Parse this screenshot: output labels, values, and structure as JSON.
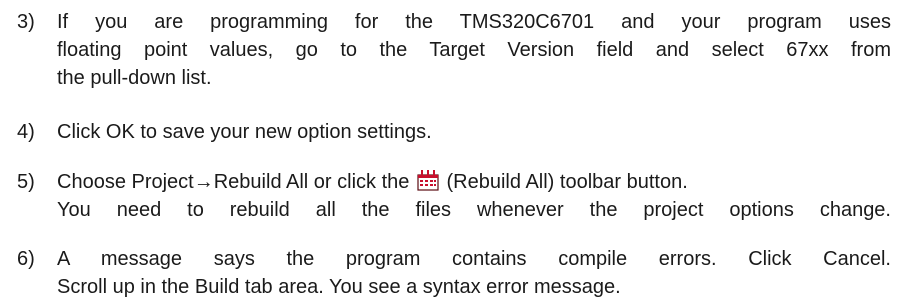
{
  "steps": [
    {
      "number": "3)",
      "lines": [
        "If you are programming for the TMS320C6701 and your program uses",
        "floating point values, go to the Target Version field and select 67xx from",
        "the pull-down list."
      ]
    },
    {
      "number": "4)",
      "lines": [
        "Click OK to save your new option settings."
      ]
    },
    {
      "number": "5)",
      "line1_before_icon": "Choose Project→Rebuild All or click the",
      "line1_after_icon": "(Rebuild All) toolbar button.",
      "line2": "You need to rebuild all the files whenever the project options change.",
      "icon": "rebuild-all-icon"
    },
    {
      "number": "6)",
      "lines": [
        "A message says the program contains compile errors. Click Cancel.",
        "Scroll up in the Build tab area. You see a syntax error message."
      ]
    }
  ],
  "colors": {
    "text": "#1a1a1a",
    "icon_red": "#c8102e",
    "icon_dark": "#5a0a12"
  }
}
